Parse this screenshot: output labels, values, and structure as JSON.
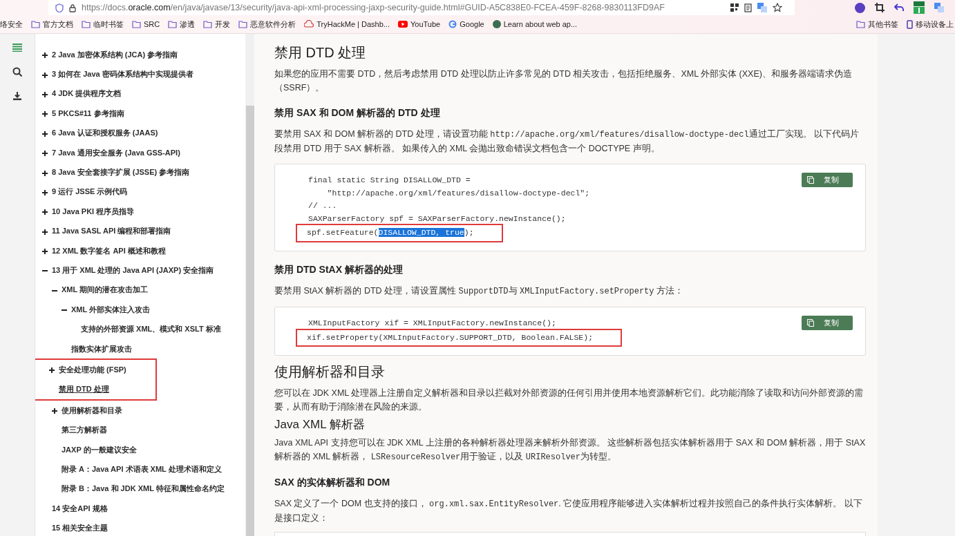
{
  "browser": {
    "url": {
      "host_before": "https://docs.",
      "host": "oracle.com",
      "path": "/en/java/javase/13/security/java-api-xml-processing-jaxp-security-guide.html#GUID-A5C838E0-FCEA-459F-8268-9830113FD9AF"
    },
    "bookmarks": [
      {
        "kind": "plain",
        "label": "络安全"
      },
      {
        "kind": "folder",
        "label": "官方文档"
      },
      {
        "kind": "folder",
        "label": "临时书签"
      },
      {
        "kind": "folder",
        "label": "SRC"
      },
      {
        "kind": "folder",
        "label": "渗透"
      },
      {
        "kind": "folder",
        "label": "开发"
      },
      {
        "kind": "folder",
        "label": "恶意软件分析"
      },
      {
        "kind": "site",
        "label": "TryHackMe | Dashb..."
      },
      {
        "kind": "video",
        "label": "YouTube"
      },
      {
        "kind": "search",
        "label": "Google"
      },
      {
        "kind": "site2",
        "label": "Learn about web ap..."
      }
    ],
    "bookmarks_right": [
      {
        "kind": "folder",
        "label": "其他书签"
      },
      {
        "kind": "device",
        "label": "移动设备上"
      }
    ]
  },
  "toc": [
    {
      "kind": "node",
      "label": "2 Java 加密体系结构 (JCA) 参考指南",
      "expanded": false
    },
    {
      "kind": "node",
      "label": "3 如何在 Java 密码体系结构中实现提供者",
      "expanded": false
    },
    {
      "kind": "node",
      "label": "4 JDK 提供程序文档",
      "expanded": false
    },
    {
      "kind": "node",
      "label": "5 PKCS#11 参考指南",
      "expanded": false
    },
    {
      "kind": "node",
      "label": "6 Java 认证和授权服务 (JAAS)",
      "expanded": false
    },
    {
      "kind": "node",
      "label": "7 Java 通用安全服务 (Java GSS-API)",
      "expanded": false
    },
    {
      "kind": "node",
      "label": "8 Java 安全套接字扩展 (JSSE) 参考指南",
      "expanded": false
    },
    {
      "kind": "node",
      "label": "9 运行 JSSE 示例代码",
      "expanded": false
    },
    {
      "kind": "node",
      "label": "10 Java PKI 程序员指导",
      "expanded": false
    },
    {
      "kind": "node",
      "label": "11 Java SASL API 编程和部署指南",
      "expanded": false
    },
    {
      "kind": "node",
      "label": "12 XML 数字签名 API 概述和教程",
      "expanded": false
    },
    {
      "kind": "node",
      "label": "13 用于 XML 处理的 Java API (JAXP) 安全指南",
      "expanded": true,
      "children": [
        {
          "kind": "node",
          "label": "XML 期间的潜在攻击加工",
          "expanded": true,
          "children": [
            {
              "kind": "node",
              "label": "XML 外部实体注入攻击",
              "expanded": true,
              "children": [
                {
                  "kind": "leaf",
                  "label": "支持的外部资源 XML、模式和 XSLT 标准"
                }
              ]
            },
            {
              "kind": "leaf",
              "label": "指数实体扩展攻击"
            }
          ]
        },
        {
          "kind": "node",
          "label": "安全处理功能 (FSP)",
          "expanded": false,
          "boxed": true
        },
        {
          "kind": "leaf",
          "label": "禁用 DTD 处理",
          "boxed": true,
          "current": true
        },
        {
          "kind": "node",
          "label": "使用解析器和目录",
          "expanded": false
        },
        {
          "kind": "leaf",
          "label": "第三方解析器"
        },
        {
          "kind": "leaf",
          "label": "JAXP 的一般建议安全"
        },
        {
          "kind": "leaf",
          "label": "附录 A：Java API 术语表 XML 处理术语和定义"
        },
        {
          "kind": "leaf",
          "label": "附录 B：Java 和 JDK XML 特征和属性命名约定"
        }
      ]
    },
    {
      "kind": "leaf",
      "label": "14 安全API 规格"
    },
    {
      "kind": "leaf",
      "label": "15 相关安全主题"
    }
  ],
  "content": [
    {
      "kind": "h2",
      "text": "禁用 DTD 处理"
    },
    {
      "kind": "p",
      "parts": [
        {
          "kind": "text",
          "text": "如果您的应用不需要 DTD，然后考虑禁用 DTD 处理以防止许多常见的 DTD 相关攻击，包括拒绝服务、XML 外部实体 (XXE)、和服务器端请求伪造（SSRF）。"
        }
      ]
    },
    {
      "kind": "h3",
      "text": "禁用 SAX 和 DOM 解析器的 DTD 处理"
    },
    {
      "kind": "p",
      "parts": [
        {
          "kind": "text",
          "text": "要禁用 SAX 和 DOM 解析器的 DTD 处理，请设置功能 "
        },
        {
          "kind": "code",
          "text": "http://apache.org/xml/features/disallow-doctype-decl"
        },
        {
          "kind": "text",
          "text": "通过工厂实现。 以下代码片段禁用 DTD 用于 SAX 解析器。 如果传入的 XML 会抛出致命错误文档包含一个 DOCTYPE 声明。"
        }
      ]
    },
    {
      "kind": "code",
      "button": "复制",
      "lines": [
        {
          "boxed": false,
          "parts": [
            {
              "text": "final static String DISALLOW_DTD =",
              "selected": false
            }
          ]
        },
        {
          "boxed": false,
          "parts": [
            {
              "text": "    \"http://apache.org/xml/features/disallow-doctype-decl\";",
              "selected": false
            }
          ]
        },
        {
          "boxed": false,
          "parts": [
            {
              "text": "// ...",
              "selected": false
            }
          ]
        },
        {
          "boxed": false,
          "parts": [
            {
              "text": "SAXParserFactory spf = SAXParserFactory.newInstance();",
              "selected": false
            }
          ]
        },
        {
          "boxed": true,
          "parts": [
            {
              "text": "spf.setFeature(",
              "selected": false
            },
            {
              "text": "DISALLOW_DTD, true",
              "selected": true
            },
            {
              "text": ");",
              "selected": false
            }
          ]
        }
      ]
    },
    {
      "kind": "h3",
      "text": "禁用 DTD StAX 解析器的处理"
    },
    {
      "kind": "p",
      "parts": [
        {
          "kind": "text",
          "text": "要禁用 StAX 解析器的 DTD 处理，请设置属性 "
        },
        {
          "kind": "code",
          "text": "SupportDTD"
        },
        {
          "kind": "text",
          "text": "与 "
        },
        {
          "kind": "code",
          "text": "XMLInputFactory.setProperty"
        },
        {
          "kind": "text",
          "text": " 方法："
        }
      ]
    },
    {
      "kind": "code",
      "button": "复制",
      "lines": [
        {
          "boxed": false,
          "parts": [
            {
              "text": "XMLInputFactory xif = XMLInputFactory.newInstance();",
              "selected": false
            }
          ]
        },
        {
          "boxed": true,
          "parts": [
            {
              "text": "xif.setProperty(XMLInputFactory.SUPPORT_DTD, Boolean.FALSE);",
              "selected": false
            }
          ]
        }
      ]
    },
    {
      "kind": "h2",
      "text": "使用解析器和目录"
    },
    {
      "kind": "p",
      "parts": [
        {
          "kind": "text",
          "text": "您可以在 JDK XML 处理器上注册自定义解析器和目录以拦截对外部资源的任何引用并使用本地资源解析它们。此功能消除了读取和访问外部资源的需要，从而有助于消除潜在风险的来源。"
        }
      ]
    },
    {
      "kind": "h2s",
      "text": "Java XML 解析器"
    },
    {
      "kind": "p",
      "parts": [
        {
          "kind": "text",
          "text": "Java XML API 支持您可以在 JDK XML 上注册的各种解析器处理器来解析外部资源。 这些解析器包括实体解析器用于 SAX 和 DOM 解析器，用于 StAX 解析器的 XML 解析器， "
        },
        {
          "kind": "code",
          "text": "LSResourceResolver"
        },
        {
          "kind": "text",
          "text": "用于验证，以及 "
        },
        {
          "kind": "code",
          "text": "URIResolver"
        },
        {
          "kind": "text",
          "text": "为转型。"
        }
      ]
    },
    {
      "kind": "h3",
      "text": "SAX 的实体解析器和 DOM"
    },
    {
      "kind": "p",
      "parts": [
        {
          "kind": "text",
          "text": "SAX 定义了一个 DOM 也支持的接口， "
        },
        {
          "kind": "code",
          "text": "org.xml.sax.EntityResolver"
        },
        {
          "kind": "text",
          "text": ". 它使应用程序能够进入实体解析过程并按照自己的条件执行实体解析。 以下是接口定义："
        }
      ]
    },
    {
      "kind": "codestub"
    }
  ]
}
